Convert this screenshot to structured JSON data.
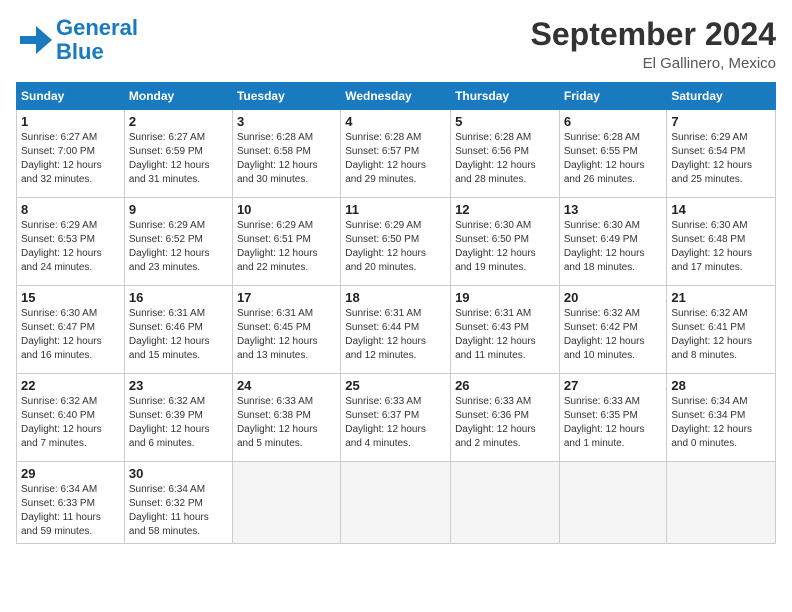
{
  "logo": {
    "line1": "General",
    "line2": "Blue"
  },
  "title": "September 2024",
  "location": "El Gallinero, Mexico",
  "headers": [
    "Sunday",
    "Monday",
    "Tuesday",
    "Wednesday",
    "Thursday",
    "Friday",
    "Saturday"
  ],
  "weeks": [
    [
      {
        "day": "1",
        "info": "Sunrise: 6:27 AM\nSunset: 7:00 PM\nDaylight: 12 hours\nand 32 minutes."
      },
      {
        "day": "2",
        "info": "Sunrise: 6:27 AM\nSunset: 6:59 PM\nDaylight: 12 hours\nand 31 minutes."
      },
      {
        "day": "3",
        "info": "Sunrise: 6:28 AM\nSunset: 6:58 PM\nDaylight: 12 hours\nand 30 minutes."
      },
      {
        "day": "4",
        "info": "Sunrise: 6:28 AM\nSunset: 6:57 PM\nDaylight: 12 hours\nand 29 minutes."
      },
      {
        "day": "5",
        "info": "Sunrise: 6:28 AM\nSunset: 6:56 PM\nDaylight: 12 hours\nand 28 minutes."
      },
      {
        "day": "6",
        "info": "Sunrise: 6:28 AM\nSunset: 6:55 PM\nDaylight: 12 hours\nand 26 minutes."
      },
      {
        "day": "7",
        "info": "Sunrise: 6:29 AM\nSunset: 6:54 PM\nDaylight: 12 hours\nand 25 minutes."
      }
    ],
    [
      {
        "day": "8",
        "info": "Sunrise: 6:29 AM\nSunset: 6:53 PM\nDaylight: 12 hours\nand 24 minutes."
      },
      {
        "day": "9",
        "info": "Sunrise: 6:29 AM\nSunset: 6:52 PM\nDaylight: 12 hours\nand 23 minutes."
      },
      {
        "day": "10",
        "info": "Sunrise: 6:29 AM\nSunset: 6:51 PM\nDaylight: 12 hours\nand 22 minutes."
      },
      {
        "day": "11",
        "info": "Sunrise: 6:29 AM\nSunset: 6:50 PM\nDaylight: 12 hours\nand 20 minutes."
      },
      {
        "day": "12",
        "info": "Sunrise: 6:30 AM\nSunset: 6:50 PM\nDaylight: 12 hours\nand 19 minutes."
      },
      {
        "day": "13",
        "info": "Sunrise: 6:30 AM\nSunset: 6:49 PM\nDaylight: 12 hours\nand 18 minutes."
      },
      {
        "day": "14",
        "info": "Sunrise: 6:30 AM\nSunset: 6:48 PM\nDaylight: 12 hours\nand 17 minutes."
      }
    ],
    [
      {
        "day": "15",
        "info": "Sunrise: 6:30 AM\nSunset: 6:47 PM\nDaylight: 12 hours\nand 16 minutes."
      },
      {
        "day": "16",
        "info": "Sunrise: 6:31 AM\nSunset: 6:46 PM\nDaylight: 12 hours\nand 15 minutes."
      },
      {
        "day": "17",
        "info": "Sunrise: 6:31 AM\nSunset: 6:45 PM\nDaylight: 12 hours\nand 13 minutes."
      },
      {
        "day": "18",
        "info": "Sunrise: 6:31 AM\nSunset: 6:44 PM\nDaylight: 12 hours\nand 12 minutes."
      },
      {
        "day": "19",
        "info": "Sunrise: 6:31 AM\nSunset: 6:43 PM\nDaylight: 12 hours\nand 11 minutes."
      },
      {
        "day": "20",
        "info": "Sunrise: 6:32 AM\nSunset: 6:42 PM\nDaylight: 12 hours\nand 10 minutes."
      },
      {
        "day": "21",
        "info": "Sunrise: 6:32 AM\nSunset: 6:41 PM\nDaylight: 12 hours\nand 8 minutes."
      }
    ],
    [
      {
        "day": "22",
        "info": "Sunrise: 6:32 AM\nSunset: 6:40 PM\nDaylight: 12 hours\nand 7 minutes."
      },
      {
        "day": "23",
        "info": "Sunrise: 6:32 AM\nSunset: 6:39 PM\nDaylight: 12 hours\nand 6 minutes."
      },
      {
        "day": "24",
        "info": "Sunrise: 6:33 AM\nSunset: 6:38 PM\nDaylight: 12 hours\nand 5 minutes."
      },
      {
        "day": "25",
        "info": "Sunrise: 6:33 AM\nSunset: 6:37 PM\nDaylight: 12 hours\nand 4 minutes."
      },
      {
        "day": "26",
        "info": "Sunrise: 6:33 AM\nSunset: 6:36 PM\nDaylight: 12 hours\nand 2 minutes."
      },
      {
        "day": "27",
        "info": "Sunrise: 6:33 AM\nSunset: 6:35 PM\nDaylight: 12 hours\nand 1 minute."
      },
      {
        "day": "28",
        "info": "Sunrise: 6:34 AM\nSunset: 6:34 PM\nDaylight: 12 hours\nand 0 minutes."
      }
    ],
    [
      {
        "day": "29",
        "info": "Sunrise: 6:34 AM\nSunset: 6:33 PM\nDaylight: 11 hours\nand 59 minutes."
      },
      {
        "day": "30",
        "info": "Sunrise: 6:34 AM\nSunset: 6:32 PM\nDaylight: 11 hours\nand 58 minutes."
      },
      {
        "day": "",
        "info": ""
      },
      {
        "day": "",
        "info": ""
      },
      {
        "day": "",
        "info": ""
      },
      {
        "day": "",
        "info": ""
      },
      {
        "day": "",
        "info": ""
      }
    ]
  ]
}
